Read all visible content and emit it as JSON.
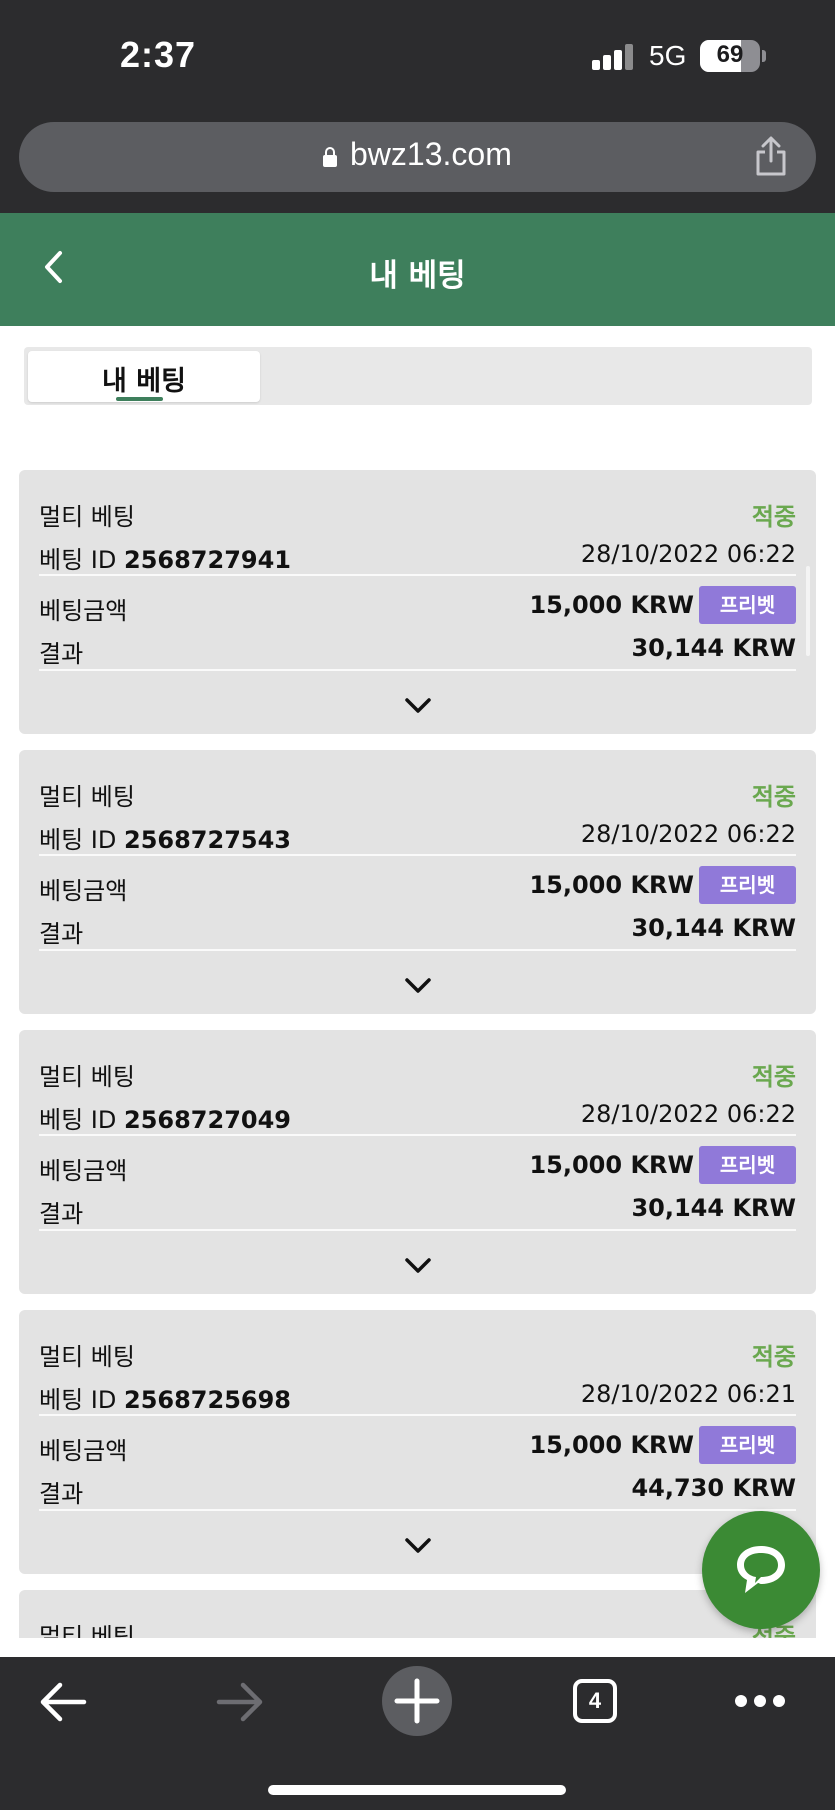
{
  "status_bar": {
    "time": "2:37",
    "network": "5G",
    "battery": "69",
    "battery_level_percent": 69
  },
  "browser": {
    "url": "bwz13.com",
    "tab_count": "4"
  },
  "header": {
    "title": "내 베팅"
  },
  "tabs": [
    {
      "label": "내 베팅",
      "active": true
    }
  ],
  "labels": {
    "bet_id_prefix": "베팅 ID",
    "amount_label": "베팅금액",
    "result_label": "결과",
    "freebet_badge": "프리벳"
  },
  "bets": [
    {
      "type": "멀티 베팅",
      "status": "적중",
      "id": "2568727941",
      "date": "28/10/2022 06:22",
      "amount": "15,000 KRW",
      "result": "30,144 KRW"
    },
    {
      "type": "멀티 베팅",
      "status": "적중",
      "id": "2568727543",
      "date": "28/10/2022 06:22",
      "amount": "15,000 KRW",
      "result": "30,144 KRW"
    },
    {
      "type": "멀티 베팅",
      "status": "적중",
      "id": "2568727049",
      "date": "28/10/2022 06:22",
      "amount": "15,000 KRW",
      "result": "30,144 KRW"
    },
    {
      "type": "멀티 베팅",
      "status": "적중",
      "id": "2568725698",
      "date": "28/10/2022 06:21",
      "amount": "15,000 KRW",
      "result": "44,730 KRW"
    },
    {
      "type": "멀티 베팅",
      "status": "적중",
      "id": "",
      "date": "",
      "amount": "",
      "result": ""
    }
  ],
  "colors": {
    "header_green": "#3e7f5c",
    "status_green": "#6aa84f",
    "freebet_purple": "#9079d9",
    "chat_green": "#3b8a34",
    "card_bg": "#e3e3e3"
  },
  "icons": {
    "back": "chevron-left-icon",
    "expand": "chevron-down-icon",
    "chat": "chat-bubble-icon",
    "share": "share-icon",
    "lock": "lock-icon"
  }
}
